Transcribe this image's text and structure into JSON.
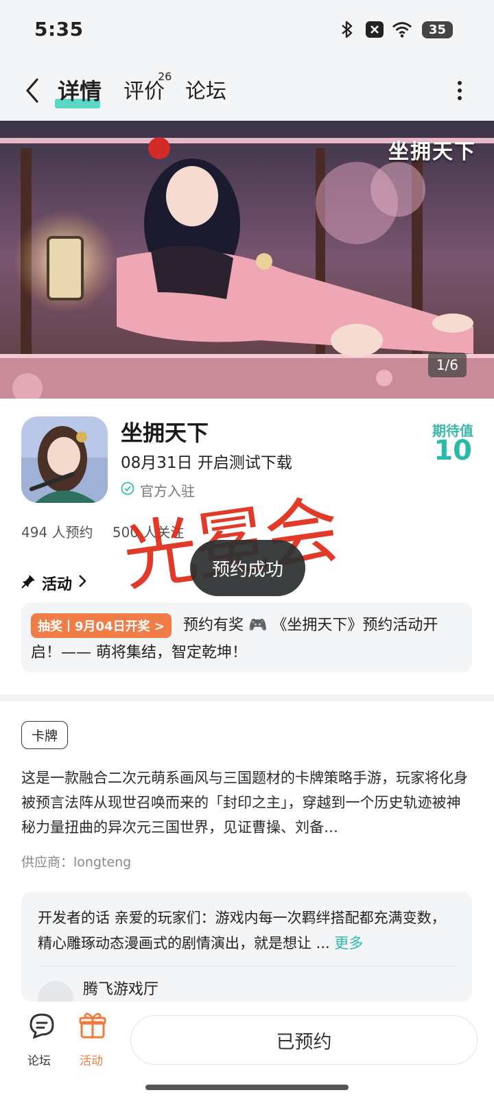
{
  "status_bar": {
    "time": "5:35",
    "battery": "35"
  },
  "nav": {
    "tabs": [
      {
        "label": "详情"
      },
      {
        "label": "评价",
        "badge": "26"
      },
      {
        "label": "论坛"
      }
    ]
  },
  "banner": {
    "logo_text": "坐拥天下",
    "page_indicator": "1/6"
  },
  "game": {
    "name": "坐拥天下",
    "release": "08月31日 开启测试下载",
    "official": "官方入驻",
    "expect_label": "期待值",
    "expect_value": "10",
    "reservations": "494 人预约",
    "followers": "500 人关注"
  },
  "activity": {
    "title": "活动",
    "badge": "抽奖丨9月04日开奖 >",
    "text": "预约有奖 🎮 《坐拥天下》预约活动开启！—— 萌将集结，智定乾坤！"
  },
  "toast": "预约成功",
  "watermark": "光冕会",
  "description": {
    "tag": "卡牌",
    "text": "这是一款融合二次元萌系画风与三国题材的卡牌策略手游，玩家将化身被预言法阵从现世召唤而来的「封印之主」，穿越到一个历史轨迹被神秘力量扭曲的异次元三国世界，见证曹操、刘备…",
    "supplier": "供应商：longteng"
  },
  "developer": {
    "text": "开发者的话  亲爱的玩家们：游戏内每一次羁绊搭配都充满变数，精心雕琢动态漫画式的剧情演出，就是想让 ... ",
    "more": "更多",
    "name": "腾飞游戏厅"
  },
  "bottom_bar": {
    "forum_label": "论坛",
    "activity_label": "活动",
    "reserve_button": "已预约"
  }
}
